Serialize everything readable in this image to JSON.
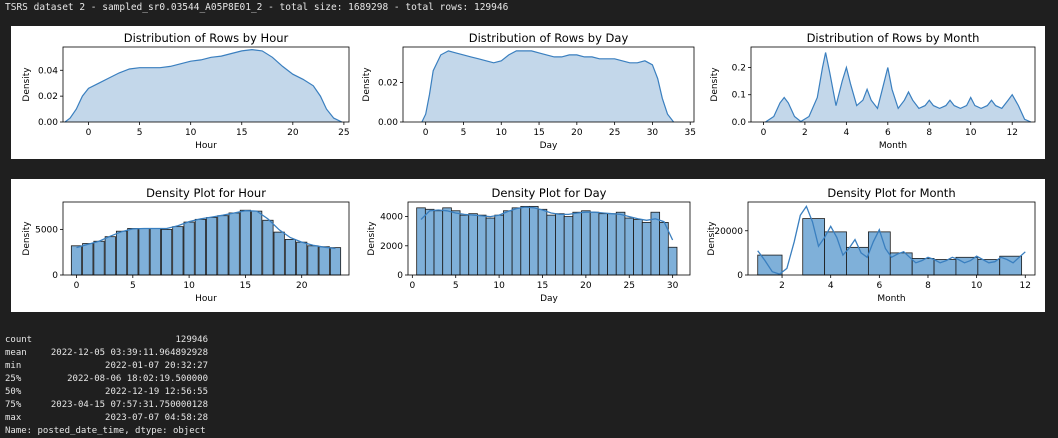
{
  "header": {
    "title": "TSRS dataset 2 - sampled_sr0.03544_A05P8E01_2 - total size: 1689298 - total rows: 129946"
  },
  "colors": {
    "kde_fill": "#c3d7ea",
    "kde_line": "#3a7fbf",
    "hist_fill": "#7fb0d9",
    "hist_edge": "#1a1a1a"
  },
  "chart_data": [
    {
      "type": "area",
      "title": "Distribution of Rows by Hour",
      "xlabel": "Hour",
      "ylabel": "Density",
      "xlim": [
        -2.5,
        25.5
      ],
      "ylim": [
        0,
        0.058
      ],
      "xticks": [
        0,
        5,
        10,
        15,
        20,
        25
      ],
      "yticks": [
        0.0,
        0.02,
        0.04
      ],
      "ytick_labels": [
        "0.00",
        "0.02",
        "0.04"
      ],
      "x": [
        -2.3,
        -1.8,
        -1.2,
        -0.6,
        0,
        1,
        2,
        3,
        4,
        5,
        6,
        7,
        8,
        9,
        10,
        11,
        12,
        13,
        14,
        15,
        16,
        17,
        18,
        19,
        20,
        21,
        22,
        22.7,
        23.3,
        24,
        24.8
      ],
      "values": [
        0.0,
        0.003,
        0.01,
        0.02,
        0.026,
        0.03,
        0.034,
        0.038,
        0.041,
        0.042,
        0.042,
        0.042,
        0.043,
        0.045,
        0.047,
        0.048,
        0.05,
        0.051,
        0.053,
        0.055,
        0.056,
        0.055,
        0.05,
        0.043,
        0.037,
        0.033,
        0.028,
        0.02,
        0.01,
        0.003,
        0.0
      ]
    },
    {
      "type": "area",
      "title": "Distribution of Rows by Day",
      "xlabel": "Day",
      "ylabel": "Density",
      "xlim": [
        -3,
        35.5
      ],
      "ylim": [
        0,
        0.038
      ],
      "xticks": [
        0,
        5,
        10,
        15,
        20,
        25,
        30,
        35
      ],
      "yticks": [
        0.0,
        0.02
      ],
      "ytick_labels": [
        "0.00",
        "0.02"
      ],
      "x": [
        -0.5,
        0,
        0.5,
        1,
        2,
        3,
        4,
        5,
        6,
        7,
        8,
        9,
        10,
        11,
        12,
        13,
        14,
        15,
        16,
        17,
        18,
        19,
        20,
        21,
        22,
        23,
        24,
        25,
        26,
        27,
        28,
        29,
        30,
        30.7,
        31.3,
        32,
        32.8
      ],
      "values": [
        0.0,
        0.004,
        0.014,
        0.026,
        0.034,
        0.036,
        0.035,
        0.034,
        0.033,
        0.032,
        0.031,
        0.03,
        0.031,
        0.034,
        0.036,
        0.036,
        0.036,
        0.035,
        0.034,
        0.033,
        0.033,
        0.034,
        0.034,
        0.033,
        0.033,
        0.032,
        0.032,
        0.032,
        0.031,
        0.03,
        0.03,
        0.031,
        0.029,
        0.022,
        0.012,
        0.004,
        0.0
      ]
    },
    {
      "type": "area",
      "title": "Distribution of Rows by Month",
      "xlabel": "Month",
      "ylabel": "Density",
      "xlim": [
        -0.6,
        13.1
      ],
      "ylim": [
        0,
        0.275
      ],
      "xticks": [
        0,
        2,
        4,
        6,
        8,
        10,
        12
      ],
      "yticks": [
        0.0,
        0.1,
        0.2
      ],
      "ytick_labels": [
        "0.0",
        "0.1",
        "0.2"
      ],
      "x": [
        0.1,
        0.5,
        0.8,
        1.0,
        1.2,
        1.5,
        1.8,
        2.2,
        2.6,
        2.85,
        3.0,
        3.2,
        3.5,
        3.8,
        4.0,
        4.2,
        4.5,
        4.8,
        5.0,
        5.2,
        5.5,
        5.8,
        6.0,
        6.2,
        6.5,
        6.8,
        7.0,
        7.2,
        7.5,
        7.8,
        8.0,
        8.2,
        8.5,
        8.8,
        9.0,
        9.2,
        9.5,
        9.8,
        10.0,
        10.2,
        10.5,
        10.8,
        11.0,
        11.2,
        11.5,
        11.8,
        12.0,
        12.3,
        12.6,
        12.9
      ],
      "values": [
        0.0,
        0.02,
        0.07,
        0.09,
        0.07,
        0.02,
        0.002,
        0.02,
        0.09,
        0.2,
        0.255,
        0.18,
        0.06,
        0.15,
        0.2,
        0.14,
        0.06,
        0.08,
        0.12,
        0.08,
        0.05,
        0.14,
        0.2,
        0.12,
        0.05,
        0.08,
        0.11,
        0.08,
        0.05,
        0.06,
        0.08,
        0.06,
        0.05,
        0.06,
        0.08,
        0.06,
        0.05,
        0.06,
        0.09,
        0.06,
        0.05,
        0.06,
        0.08,
        0.06,
        0.05,
        0.08,
        0.1,
        0.06,
        0.01,
        0.0
      ]
    },
    {
      "type": "bar",
      "title": "Density Plot for Hour",
      "xlabel": "Hour",
      "ylabel": "Density",
      "xlim": [
        -1.2,
        24.2
      ],
      "ylim": [
        0,
        8000
      ],
      "xticks": [
        0,
        5,
        10,
        15,
        20
      ],
      "yticks": [
        0,
        5000
      ],
      "ytick_labels": [
        "0",
        "5000"
      ],
      "bin_width": 0.92,
      "categories": [
        0,
        1,
        2,
        3,
        4,
        5,
        6,
        7,
        8,
        9,
        10,
        11,
        12,
        13,
        14,
        15,
        16,
        17,
        18,
        19,
        20,
        21,
        22,
        23
      ],
      "values": [
        3200,
        3450,
        3700,
        4200,
        4800,
        5100,
        5100,
        5100,
        5000,
        5300,
        5800,
        6100,
        6300,
        6500,
        6800,
        7100,
        7000,
        6000,
        4700,
        3900,
        3600,
        3200,
        3100,
        3000
      ],
      "kde": [
        3000,
        3350,
        3700,
        4250,
        4750,
        5050,
        5100,
        5100,
        5100,
        5400,
        5850,
        6150,
        6350,
        6550,
        6800,
        7050,
        7000,
        6150,
        4950,
        4100,
        3600,
        3250,
        3050,
        2900
      ]
    },
    {
      "type": "bar",
      "title": "Density Plot for Day",
      "xlabel": "Day",
      "ylabel": "Density",
      "xlim": [
        -0.5,
        32
      ],
      "ylim": [
        0,
        5000
      ],
      "xticks": [
        0,
        5,
        10,
        15,
        20,
        25,
        30
      ],
      "yticks": [
        0,
        2000,
        4000
      ],
      "ytick_labels": [
        "0",
        "2000",
        "4000"
      ],
      "bin_width": 1,
      "categories": [
        1,
        2,
        3,
        4,
        5,
        6,
        7,
        8,
        9,
        10,
        11,
        12,
        13,
        14,
        15,
        16,
        17,
        18,
        19,
        20,
        21,
        22,
        23,
        24,
        25,
        26,
        27,
        28,
        29,
        30
      ],
      "values": [
        4600,
        4500,
        4400,
        4600,
        4400,
        4100,
        4200,
        4100,
        3900,
        4100,
        4400,
        4600,
        4700,
        4700,
        4500,
        4100,
        4200,
        4000,
        4300,
        4400,
        4300,
        4200,
        4200,
        4300,
        3900,
        3800,
        3600,
        4300,
        3600,
        1900
      ],
      "kde": [
        3800,
        4400,
        4450,
        4400,
        4250,
        4150,
        4100,
        4050,
        4000,
        4100,
        4350,
        4550,
        4650,
        4600,
        4450,
        4250,
        4150,
        4150,
        4250,
        4300,
        4300,
        4250,
        4200,
        4150,
        4000,
        3850,
        3750,
        3850,
        3650,
        2400
      ]
    },
    {
      "type": "bar",
      "title": "Density Plot for Month",
      "xlabel": "Month",
      "ylabel": "Density",
      "xlim": [
        0.6,
        12.4
      ],
      "ylim": [
        0,
        33000
      ],
      "xticks": [
        2,
        4,
        6,
        8,
        10,
        12
      ],
      "yticks": [
        0,
        20000
      ],
      "ytick_labels": [
        "0",
        "20000"
      ],
      "bin_width": 1,
      "categories": [
        1.5,
        3.5,
        4.5,
        5.5,
        6.5,
        7.5,
        8.5,
        9.5,
        10.5,
        11.5
      ],
      "bins": [
        [
          1,
          2
        ],
        [
          2.85,
          3.75
        ],
        [
          3.75,
          4.65
        ],
        [
          4.65,
          5.55
        ],
        [
          5.55,
          6.45
        ],
        [
          6.45,
          7.35
        ],
        [
          7.35,
          8.25
        ],
        [
          8.25,
          9.15
        ],
        [
          9.15,
          10.05
        ],
        [
          10.05,
          10.95
        ],
        [
          10.95,
          11.85
        ]
      ],
      "values": [
        9000,
        25500,
        19500,
        12500,
        19500,
        10000,
        7500,
        7000,
        8000,
        7000,
        8500
      ],
      "kde_x": [
        1.0,
        1.3,
        1.6,
        1.9,
        2.2,
        2.5,
        2.75,
        3.0,
        3.25,
        3.5,
        3.75,
        4.0,
        4.25,
        4.5,
        4.75,
        5.0,
        5.25,
        5.5,
        5.75,
        6.0,
        6.25,
        6.5,
        6.75,
        7.0,
        7.25,
        7.5,
        7.75,
        8.0,
        8.25,
        8.5,
        8.75,
        9.0,
        9.25,
        9.5,
        9.75,
        10.0,
        10.25,
        10.5,
        10.75,
        11.0,
        11.25,
        11.5,
        11.75,
        12.0
      ],
      "kde": [
        11000,
        6500,
        1500,
        400,
        3000,
        15000,
        27000,
        31000,
        24000,
        13000,
        17000,
        22000,
        17000,
        9000,
        12000,
        16000,
        10000,
        8000,
        15000,
        20500,
        12000,
        8000,
        9500,
        10500,
        8000,
        5500,
        6500,
        8000,
        7000,
        5500,
        6500,
        8000,
        7000,
        5500,
        6500,
        8500,
        7000,
        5500,
        6000,
        8000,
        7000,
        5500,
        8000,
        10500
      ]
    }
  ],
  "stats": {
    "rows": [
      {
        "key": "count",
        "value": "129946"
      },
      {
        "key": "mean",
        "value": "2022-12-05 03:39:11.964892928"
      },
      {
        "key": "min",
        "value": "2022-01-07 20:32:27"
      },
      {
        "key": "25%",
        "value": "2022-08-06 18:02:19.500000"
      },
      {
        "key": "50%",
        "value": "2022-12-19 12:56:55"
      },
      {
        "key": "75%",
        "value": "2023-04-15 07:57:31.750000128"
      },
      {
        "key": "max",
        "value": "2023-07-07 04:58:28"
      }
    ],
    "footer": "Name: posted_date_time, dtype: object"
  }
}
